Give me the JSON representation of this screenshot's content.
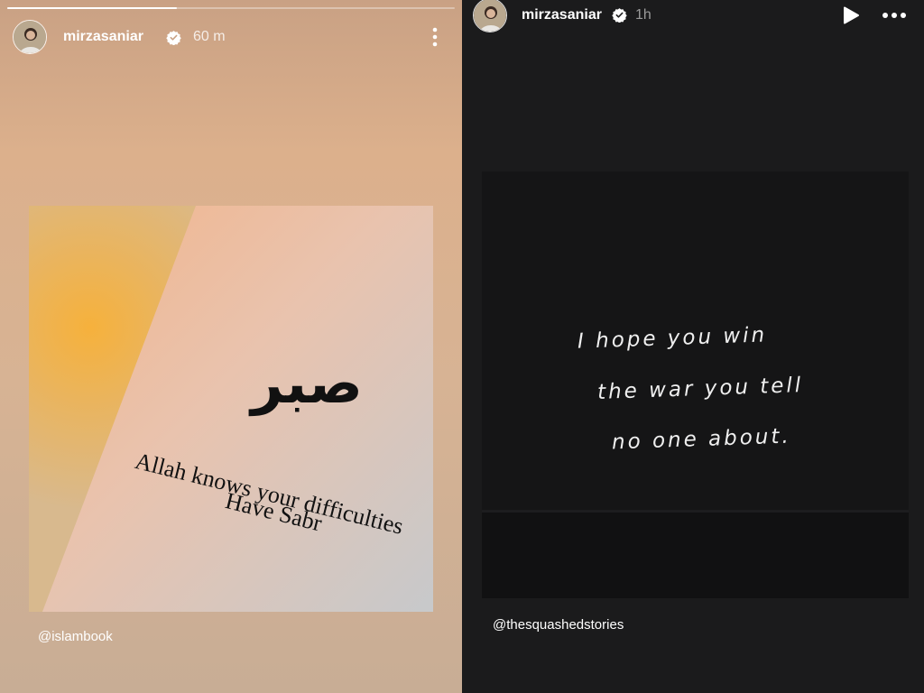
{
  "left_story": {
    "username": "mirzasaniar",
    "time": "60 m",
    "progress": 0.38,
    "image": {
      "arabic_word": "صبر",
      "line1": "Allah knows your difficulties",
      "line2": "Have Sabr"
    },
    "mention": "@islambook"
  },
  "right_story": {
    "username": "mirzasaniar",
    "time": "1h",
    "image": {
      "line1": "I hope you win",
      "line2": "the war you tell",
      "line3": "no one about."
    },
    "mention": "@thesquashedstories"
  },
  "colors": {
    "verified_badge": "#ffffff",
    "left_bg": "#d8b090",
    "right_bg": "#1b1b1c"
  },
  "icons": {
    "left_menu": "vertical-ellipsis-icon",
    "right_play": "play-icon",
    "right_menu": "horizontal-ellipsis-icon",
    "verified": "verified-badge-icon"
  }
}
